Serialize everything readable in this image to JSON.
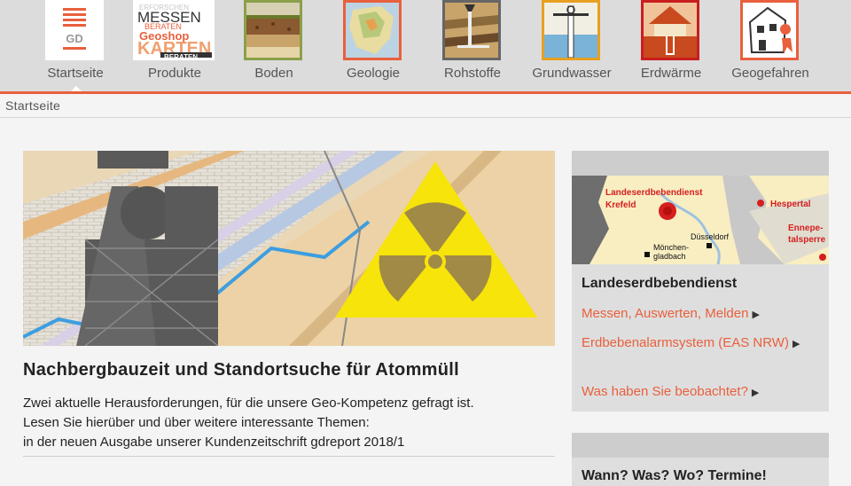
{
  "nav": {
    "items": [
      {
        "label": "Startseite",
        "icon": "gd-logo-icon"
      },
      {
        "label": "Produkte",
        "icon": "geoshop-icon"
      },
      {
        "label": "Boden",
        "icon": "soil-profile-icon"
      },
      {
        "label": "Geologie",
        "icon": "geology-map-icon"
      },
      {
        "label": "Rohstoffe",
        "icon": "mining-icon"
      },
      {
        "label": "Grundwasser",
        "icon": "well-icon"
      },
      {
        "label": "Erdwärme",
        "icon": "geothermal-house-icon"
      },
      {
        "label": "Geogefahren",
        "icon": "collapsing-house-icon"
      }
    ],
    "logo_text": "GD",
    "geoshop": {
      "line1": "MESSEN",
      "line2": "BERATEN",
      "line3": "Geoshop",
      "line4": "KARTEN",
      "line5": "BERATEN",
      "top": "ERFORSCHEN"
    },
    "accent": "#e8603c"
  },
  "breadcrumb": "Startseite",
  "article": {
    "title": "Nachbergbauzeit und Standortsuche für Atommüll",
    "lines": [
      "Zwei aktuelle Herausforderungen, für die unsere Geo-Kompetenz gefragt ist.",
      "Lesen Sie hierüber und über weitere interessante Themen:",
      "in der neuen Ausgabe unserer Kundenzeitschrift gdreport 2018/1"
    ]
  },
  "sidebar": {
    "map_labels": {
      "service": "Landeserdbebendienst",
      "krefeld": "Krefeld",
      "hespertal": "Hespertal",
      "duesseldorf": "Düsseldorf",
      "moenchen1": "Mönchen-",
      "moenchen2": "gladbach",
      "ennepe1": "Ennepe-",
      "ennepe2": "talsperre"
    },
    "title": "Landeserdbebendienst",
    "links": [
      "Messen, Auswerten, Melden",
      "Erdbebenalarmsystem (EAS NRW)",
      "Was haben Sie beobachtet?"
    ],
    "box2_title": "Wann? Was? Wo? Termine!"
  }
}
